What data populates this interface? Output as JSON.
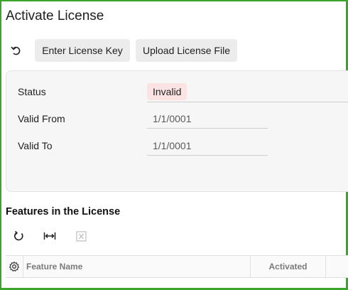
{
  "page": {
    "title": "Activate License"
  },
  "toolbar": {
    "undo_icon": "undo-icon",
    "enter_key_label": "Enter License Key",
    "upload_file_label": "Upload License File"
  },
  "license": {
    "status_label": "Status",
    "status_value": "Invalid",
    "status_color": "#fbe3e3",
    "valid_from_label": "Valid From",
    "valid_from_value": "1/1/0001",
    "valid_to_label": "Valid To",
    "valid_to_value": "1/1/0001"
  },
  "features": {
    "title": "Features in the License",
    "toolbar_icons": [
      "refresh-icon",
      "fit-columns-icon",
      "export-excel-icon"
    ],
    "columns": [
      "Feature Name",
      "Activated"
    ]
  },
  "colors": {
    "frame": "#3aa52a",
    "panel": "#f6f6f6",
    "button": "#ececec"
  }
}
